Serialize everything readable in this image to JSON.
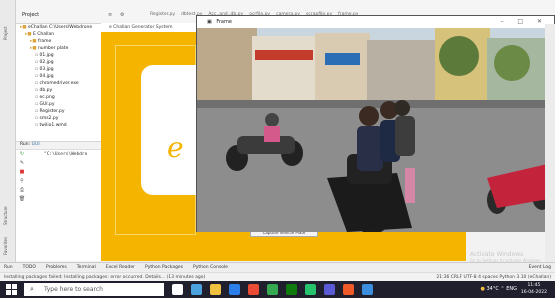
{
  "ide": {
    "project_label": "Project",
    "tabs": [
      "Register.py",
      "dbtest.py",
      "Acc..and..db.py",
      "ocrfile.py",
      "camera.py",
      "scrapfile.py",
      "frame.py"
    ],
    "tree": [
      {
        "label": "eChallan  C:\\Users\\Webdrone",
        "type": "folder",
        "indent": 0
      },
      {
        "label": "E Challan",
        "type": "folder",
        "indent": 1
      },
      {
        "label": "frame",
        "type": "folder",
        "indent": 2
      },
      {
        "label": "number plate",
        "type": "folder",
        "indent": 2
      },
      {
        "label": "01.jpg",
        "type": "file",
        "indent": 3
      },
      {
        "label": "02.jpg",
        "type": "file",
        "indent": 3
      },
      {
        "label": "03.jpg",
        "type": "file",
        "indent": 3
      },
      {
        "label": "04.jpg",
        "type": "file",
        "indent": 3
      },
      {
        "label": "chromedriver.exe",
        "type": "file",
        "indent": 3
      },
      {
        "label": "db.py",
        "type": "file",
        "indent": 3
      },
      {
        "label": "ec.png",
        "type": "file",
        "indent": 3
      },
      {
        "label": "GUI.py",
        "type": "file",
        "indent": 3
      },
      {
        "label": "Register.py",
        "type": "file",
        "indent": 3
      },
      {
        "label": "sms2.py",
        "type": "file",
        "indent": 3
      },
      {
        "label": "twilio1.wmd",
        "type": "file",
        "indent": 3
      }
    ],
    "run_label": "Run:",
    "run_target": "GUI",
    "console_line": "\"C:\\Users\\Webdro",
    "tool_tabs": [
      "Run",
      "TODO",
      "Problems",
      "Terminal",
      "Excel Reader",
      "Python Packages",
      "Python Console"
    ],
    "event_log": "Event Log",
    "status_text": "Installing packages failed: Installing packages: error occurred. Details... (13 minutes ago)",
    "status_right": "21:36   CRLF   UTF-8   4 spaces   Python 3.10 (eChallan)"
  },
  "generator_window": {
    "title": "e Challan Generator System",
    "button_label": "Capture Vehicle Plate"
  },
  "frame_window": {
    "title": "Frame",
    "controls": "– □ ✕"
  },
  "watermark": {
    "line1": "Activate Windows",
    "line2": "Go to Settings to activate Windows."
  },
  "taskbar": {
    "search_placeholder": "Type here to search",
    "weather": "34°C",
    "lang": "ENG",
    "time": "11:45",
    "date": "16-04-2022"
  },
  "colors": {
    "accent_yellow": "#f4b400",
    "taskbar": "#1f1f2e"
  }
}
